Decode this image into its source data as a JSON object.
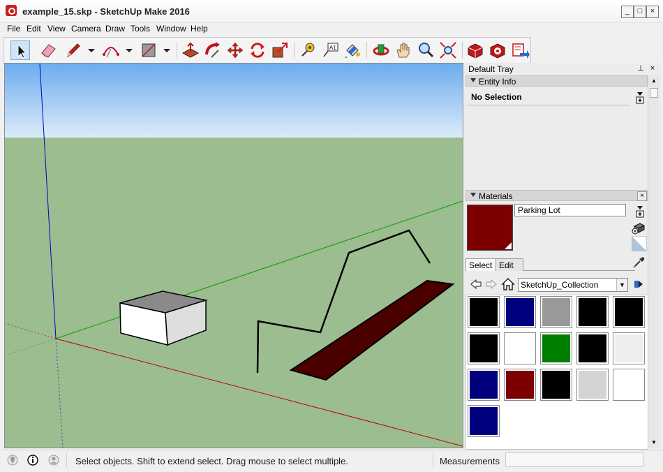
{
  "window": {
    "title": "example_15.skp - SketchUp Make 2016",
    "controls": [
      "minimize-icon",
      "maximize-icon",
      "close-icon"
    ]
  },
  "menu": [
    "File",
    "Edit",
    "View",
    "Camera",
    "Draw",
    "Tools",
    "Window",
    "Help"
  ],
  "toolbar": {
    "tools": [
      {
        "name": "select-tool",
        "icon": "arrow-cursor-icon",
        "selected": true
      },
      {
        "name": "eraser-tool",
        "icon": "eraser-icon"
      },
      {
        "name": "pencil-line-tool",
        "icon": "pencil-icon"
      },
      {
        "name": "arc-tool",
        "icon": "arc-icon"
      },
      {
        "name": "rectangle-tool",
        "icon": "rectangle-icon"
      },
      {
        "name": "push-pull-tool",
        "icon": "push-pull-icon"
      },
      {
        "name": "follow-me-tool",
        "icon": "follow-me-icon"
      },
      {
        "name": "move-tool",
        "icon": "move-icon"
      },
      {
        "name": "rotate-tool",
        "icon": "rotate-icon"
      },
      {
        "name": "scale-tool",
        "icon": "scale-icon"
      },
      {
        "name": "tape-measure-tool",
        "icon": "tape-measure-icon"
      },
      {
        "name": "text-tool",
        "icon": "text-icon"
      },
      {
        "name": "paint-bucket-tool",
        "icon": "paint-bucket-icon"
      },
      {
        "name": "orbit-tool",
        "icon": "orbit-icon"
      },
      {
        "name": "pan-tool",
        "icon": "hand-icon"
      },
      {
        "name": "zoom-tool",
        "icon": "magnifier-icon"
      },
      {
        "name": "zoom-extents-tool",
        "icon": "zoom-extents-icon"
      },
      {
        "name": "3d-warehouse-tool",
        "icon": "warehouse-icon"
      },
      {
        "name": "extension-warehouse-tool",
        "icon": "extension-icon"
      },
      {
        "name": "share-model-tool",
        "icon": "share-icon"
      }
    ]
  },
  "tray": {
    "title": "Default Tray",
    "entity_info": {
      "header": "Entity Info",
      "selection": "No Selection"
    },
    "materials": {
      "header": "Materials",
      "current_name": "Parking Lot",
      "current_color": "#7c0000",
      "tabs": [
        "Select",
        "Edit"
      ],
      "active_tab": "Select",
      "collection": "SketchUp_Collection",
      "swatches": [
        "#000000",
        "#00007f",
        "#999999",
        "#000000",
        "#000000",
        "#000000",
        "#ffffff",
        "#007f00",
        "#000000",
        "#eeeeee",
        "#00007f",
        "#7c0000",
        "#000000",
        "#d4d4d4",
        "#ffffff",
        "#00007f"
      ]
    }
  },
  "status": {
    "message": "Select objects. Shift to extend select. Drag mouse to select multiple.",
    "measurements_label": "Measurements",
    "measurements_value": ""
  },
  "colors": {
    "sky_top": "#6cacef",
    "sky_bottom": "#dcebf8",
    "ground": "#9bbd8f",
    "axis_red": "#c00000",
    "axis_green": "#00a000",
    "axis_blue": "#0000c0"
  }
}
